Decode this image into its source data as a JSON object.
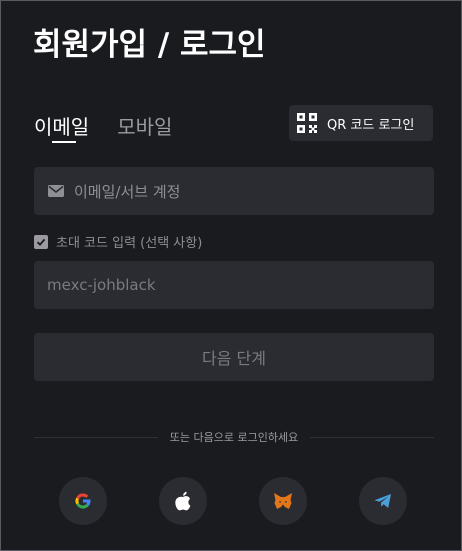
{
  "header": {
    "title": "회원가입 / 로그인"
  },
  "tabs": [
    {
      "label": "이메일",
      "active": true
    },
    {
      "label": "모바일",
      "active": false
    }
  ],
  "qr_login": {
    "label": "QR 코드 로그인",
    "icon": "qr-code-icon"
  },
  "email_field": {
    "placeholder": "이메일/서브 계정",
    "icon": "mail-icon"
  },
  "referral": {
    "label": "초대 코드 입력 (선택 사항)",
    "checked": true
  },
  "referral_field": {
    "value": "mexc-johblack"
  },
  "next_button": {
    "label": "다음 단계"
  },
  "divider": {
    "label": "또는 다음으로 로그인하세요"
  },
  "social_logins": [
    {
      "name": "google",
      "icon": "google-icon"
    },
    {
      "name": "apple",
      "icon": "apple-icon"
    },
    {
      "name": "metamask",
      "icon": "metamask-fox-icon"
    },
    {
      "name": "telegram",
      "icon": "telegram-icon"
    }
  ],
  "colors": {
    "background": "#1a1b1f",
    "surface": "#2b2c31",
    "text": "#ffffff",
    "muted": "#8e8e95",
    "telegram": "#4a9fd8"
  }
}
